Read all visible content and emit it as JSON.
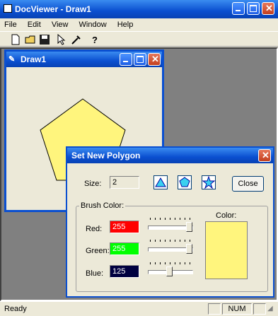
{
  "app": {
    "title": "DocViewer - Draw1"
  },
  "menu": [
    "File",
    "Edit",
    "View",
    "Window",
    "Help"
  ],
  "toolbar": {
    "icons": [
      "new-icon",
      "open-icon",
      "save-icon",
      "cursor-icon",
      "tool-icon",
      "help-icon"
    ]
  },
  "child": {
    "title": "Draw1"
  },
  "dialog": {
    "title": "Set New Polygon",
    "size_label": "Size:",
    "size_value": "2",
    "close_label": "Close",
    "group_label": "Brush Color:",
    "color_label": "Color:",
    "red_label": "Red:",
    "red_value": "255",
    "green_label": "Green:",
    "green_value": "255",
    "blue_label": "Blue:",
    "blue_value": "125",
    "red_level": 1.0,
    "green_level": 1.0,
    "blue_level": 0.49
  },
  "status": {
    "text": "Ready",
    "num": "NUM"
  },
  "colors": {
    "polygon": "#fff57d",
    "red_field": "#ff0000",
    "green_field": "#00ff00",
    "blue_field": "#000040",
    "mdi_bg": "#808080"
  }
}
